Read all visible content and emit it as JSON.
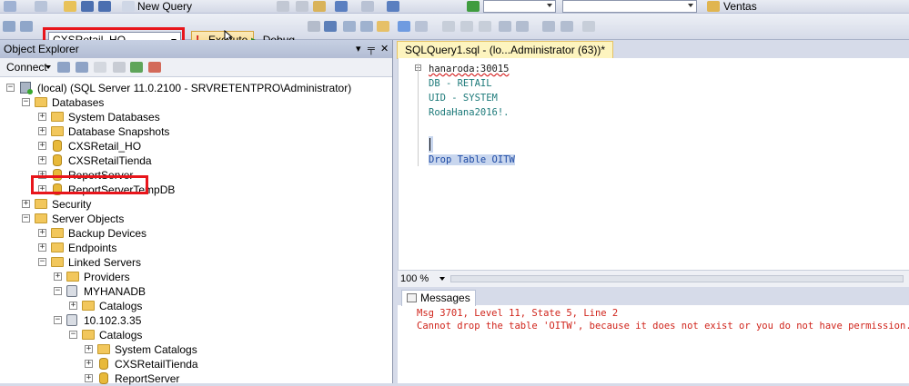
{
  "toolbar_top": {
    "new_query_label": "New Query",
    "database_combo_value": "Ventas"
  },
  "toolbar_sql": {
    "database_selector": "CXSRetail_HO",
    "execute_label": "Execute",
    "debug_label": "Debug"
  },
  "object_explorer": {
    "title": "Object Explorer",
    "pin_glyph": "▾ ᛫ ✕",
    "connect_label": "Connect",
    "tree": [
      {
        "label": "(local) (SQL Server 11.0.2100 - SRVRETENTPRO\\Administrator)"
      },
      {
        "label": "Databases"
      },
      {
        "label": "System Databases"
      },
      {
        "label": "Database Snapshots"
      },
      {
        "label": "CXSRetail_HO"
      },
      {
        "label": "CXSRetailTienda"
      },
      {
        "label": "ReportServer"
      },
      {
        "label": "ReportServerTempDB"
      },
      {
        "label": "Security"
      },
      {
        "label": "Server Objects"
      },
      {
        "label": "Backup Devices"
      },
      {
        "label": "Endpoints"
      },
      {
        "label": "Linked Servers"
      },
      {
        "label": "Providers"
      },
      {
        "label": "MYHANADB"
      },
      {
        "label": "Catalogs"
      },
      {
        "label": "10.102.3.35"
      },
      {
        "label": "Catalogs"
      },
      {
        "label": "System Catalogs"
      },
      {
        "label": "CXSRetailTienda"
      },
      {
        "label": "ReportServer"
      }
    ]
  },
  "editor": {
    "tab_title": "SQLQuery1.sql - (lo...Administrator (63))*",
    "lines": [
      "hanaroda:30015",
      "DB - RETAIL",
      "UID - SYSTEM",
      "RodaHana2016!.",
      "",
      "",
      "Drop Table OITW"
    ],
    "zoom": "100 %"
  },
  "results": {
    "tab_label": "Messages",
    "messages": [
      "Msg 3701, Level 11, State 5, Line 2",
      "Cannot drop the table 'OITW', because it does not exist or you do not have permission."
    ]
  },
  "colors": {
    "highlight_box": "#e8151b",
    "error_text": "#d0241b",
    "editor_tab": "#fdf4bf"
  }
}
